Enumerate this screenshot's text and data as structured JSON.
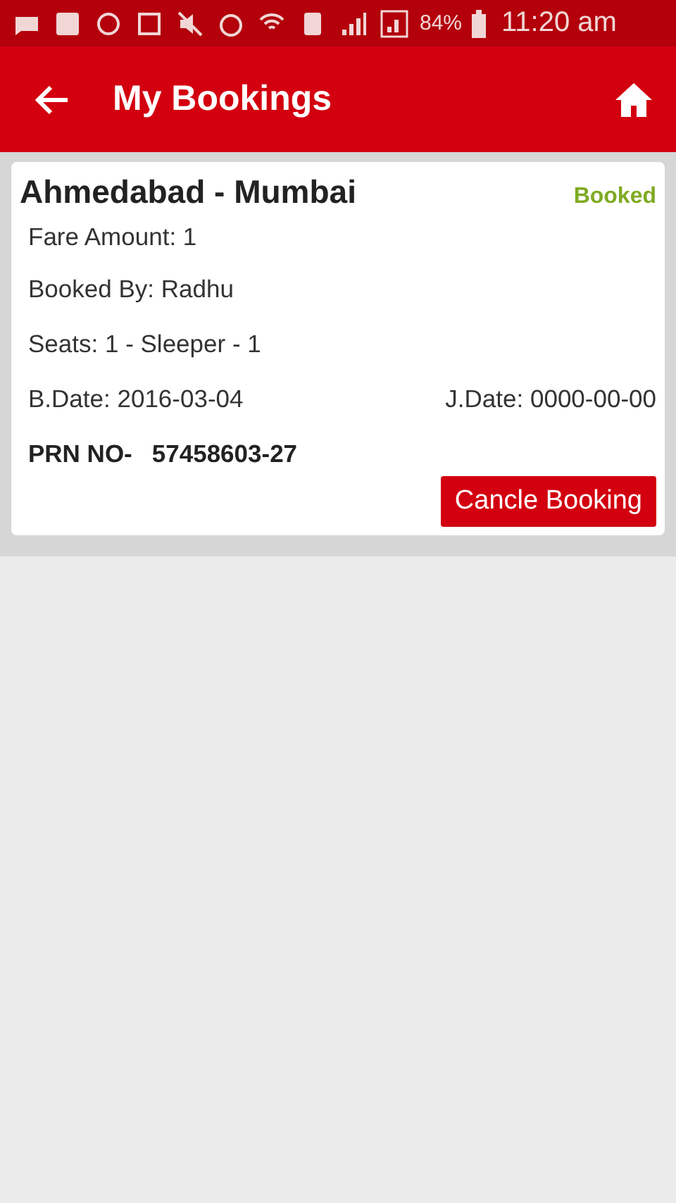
{
  "status_bar": {
    "battery": "84%",
    "time": "11:20 am"
  },
  "app_bar": {
    "title": "My Bookings"
  },
  "bookings": [
    {
      "route": "Ahmedabad - Mumbai",
      "status": "Booked",
      "fare": "Fare Amount: 1",
      "booked_by": "Booked By: Radhu",
      "seats": "Seats: 1 - Sleeper - 1",
      "b_date": "B.Date: 2016-03-04",
      "j_date": "J.Date: 0000-00-00",
      "prn_label": "PRN NO-",
      "prn": "57458603-27",
      "button": "Cancle Booking"
    }
  ]
}
